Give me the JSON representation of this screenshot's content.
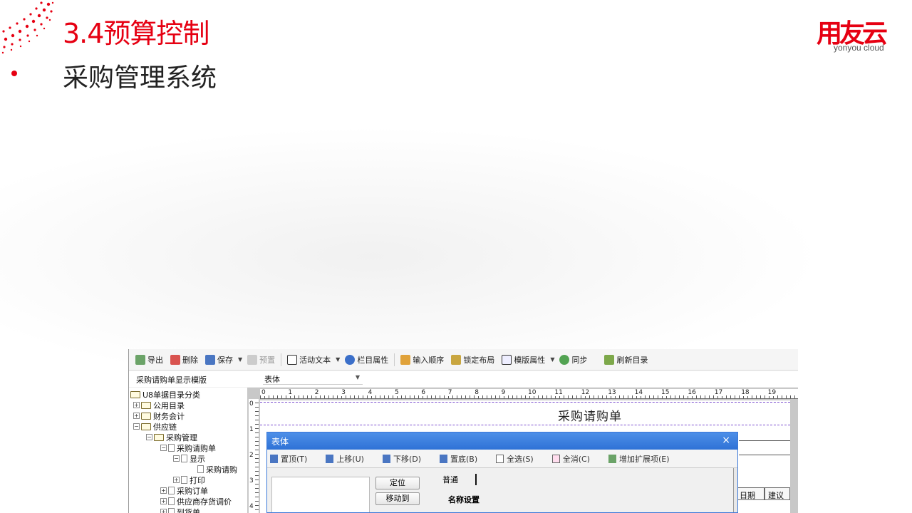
{
  "slide": {
    "title": "3.4预算控制",
    "bullet": "采购管理系统",
    "logo_mark": "用友云",
    "logo_sub": "yonyou cloud",
    "accent_color": "#e60012"
  },
  "toolbar": {
    "items": [
      {
        "label": "导出",
        "icon": "export-icon",
        "enabled": true
      },
      {
        "label": "删除",
        "icon": "delete-icon",
        "enabled": true
      },
      {
        "label": "保存",
        "icon": "save-icon",
        "enabled": true
      },
      {
        "label": "预置",
        "icon": "preset-icon",
        "enabled": false
      },
      {
        "label": "活动文本",
        "icon": "text-icon",
        "enabled": true
      },
      {
        "label": "栏目属性",
        "icon": "column-props-icon",
        "enabled": true
      },
      {
        "label": "输入顺序",
        "icon": "order-icon",
        "enabled": true
      },
      {
        "label": "锁定布局",
        "icon": "lock-icon",
        "enabled": true
      },
      {
        "label": "模版属性",
        "icon": "template-props-icon",
        "enabled": true
      },
      {
        "label": "同步",
        "icon": "sync-icon",
        "enabled": true
      },
      {
        "label": "刷新目录",
        "icon": "refresh-icon",
        "enabled": true
      }
    ]
  },
  "subbar": {
    "template_name": "采购请购单显示模版",
    "section": "表体"
  },
  "tree": {
    "items": [
      {
        "label": "U8单据目录分类",
        "level": 0,
        "type": "folder",
        "toggle": ""
      },
      {
        "label": "公用目录",
        "level": 1,
        "type": "folder",
        "toggle": "+"
      },
      {
        "label": "财务会计",
        "level": 1,
        "type": "folder",
        "toggle": "+"
      },
      {
        "label": "供应链",
        "level": 1,
        "type": "folder",
        "toggle": "-"
      },
      {
        "label": "采购管理",
        "level": 2,
        "type": "folder",
        "toggle": "-"
      },
      {
        "label": "采购请购单",
        "level": 3,
        "type": "doc",
        "toggle": "-"
      },
      {
        "label": "显示",
        "level": 4,
        "type": "doc",
        "toggle": "-"
      },
      {
        "label": "采购请购",
        "level": 5,
        "type": "doc",
        "toggle": ""
      },
      {
        "label": "打印",
        "level": 4,
        "type": "doc",
        "toggle": "+"
      },
      {
        "label": "采购订单",
        "level": 3,
        "type": "doc",
        "toggle": "+"
      },
      {
        "label": "供应商存货调价",
        "level": 3,
        "type": "doc",
        "toggle": "+"
      },
      {
        "label": "到货单",
        "level": 3,
        "type": "doc",
        "toggle": "+"
      }
    ]
  },
  "ruler": {
    "top_numbers": [
      "0",
      "1",
      "2",
      "3",
      "4",
      "5",
      "6",
      "7",
      "8",
      "9",
      "10",
      "11",
      "12",
      "13",
      "14",
      "15",
      "16",
      "17",
      "18",
      "19"
    ],
    "left_numbers": [
      "0",
      "1",
      "2",
      "3",
      "4"
    ]
  },
  "document": {
    "title": "采购请购单",
    "col_headers": [
      "日期",
      "建议"
    ]
  },
  "dialog": {
    "title": "表体",
    "close": "×",
    "tools": [
      {
        "label": "置顶(T)",
        "icon": "top-icon"
      },
      {
        "label": "上移(U)",
        "icon": "up-icon"
      },
      {
        "label": "下移(D)",
        "icon": "down-icon"
      },
      {
        "label": "置底(B)",
        "icon": "bottom-icon"
      },
      {
        "label": "全选(S)",
        "icon": "select-all-icon"
      },
      {
        "label": "全消(C)",
        "icon": "deselect-icon"
      },
      {
        "label": "增加扩展项(E)",
        "icon": "add-ext-icon"
      }
    ],
    "locate_button": "定位",
    "move_button": "移动到",
    "common_tab": "普通",
    "name_settings": "名称设置"
  }
}
